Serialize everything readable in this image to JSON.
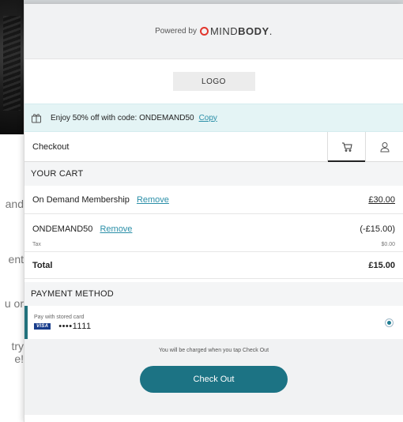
{
  "background_page": {
    "fragments": [
      "and",
      "ent",
      "u or",
      "try",
      "e!"
    ]
  },
  "header": {
    "powered_by": "Powered by",
    "brand_name_light": "MIND",
    "brand_name_bold": "BODY",
    "brand_color": "#e2352c"
  },
  "logo": {
    "label": "LOGO"
  },
  "promo": {
    "icon": "gift-icon",
    "text": "Enjoy 50% off with code: ONDEMAND50",
    "copy_label": "Copy"
  },
  "checkout_bar": {
    "title": "Checkout",
    "tabs": [
      {
        "icon": "cart-icon",
        "active": true
      },
      {
        "icon": "user-icon",
        "active": false
      }
    ]
  },
  "cart": {
    "heading": "YOUR CART",
    "items": [
      {
        "name": "On Demand Membership",
        "remove_label": "Remove",
        "price": "£30.00"
      },
      {
        "name": "ONDEMAND50",
        "remove_label": "Remove",
        "price": "(-£15.00)"
      }
    ],
    "tax_label": "Tax",
    "tax_value": "$0.00",
    "total_label": "Total",
    "total_value": "£15.00"
  },
  "payment": {
    "heading": "PAYMENT METHOD",
    "stored_card_label": "Pay with stored card",
    "card_brand": "VISA",
    "card_number": "••••1111",
    "selected": true
  },
  "footer": {
    "note": "You will be charged when you tap Check Out",
    "button_label": "Check Out",
    "accent": "#1c7384"
  }
}
